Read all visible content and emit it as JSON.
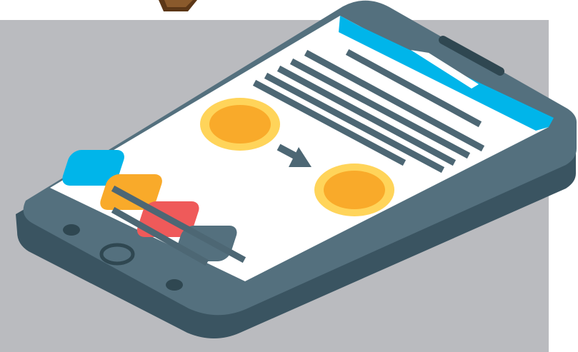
{
  "illustration": {
    "subject": "isometric-smartphone",
    "colors": {
      "background_panel": "#babbbf",
      "phone_body": "#54707e",
      "phone_body_dark": "#2f4751",
      "phone_side": "#3a5461",
      "screen": "#ffffff",
      "status_bar": "#00b5ea",
      "status_highlight": "#ffffff",
      "text_lines": "#4d6774",
      "coin_outer": "#ffd45a",
      "coin_inner": "#f9aa2a",
      "arrow": "#4d6774",
      "tile_blue": "#00b5ea",
      "tile_orange": "#f9aa2a",
      "tile_red": "#ef5a5a",
      "tile_slate": "#54707e",
      "wood_top": "#8a5a2c",
      "wood_dark": "#5c3717"
    },
    "icons": {
      "arrow": "arrow-down-right-icon",
      "coin_from": "coin-icon",
      "coin_to": "coin-icon",
      "speaker": "speaker-icon",
      "home_button": "home-button-icon",
      "camera": "camera-icon",
      "sensor": "sensor-icon"
    }
  }
}
